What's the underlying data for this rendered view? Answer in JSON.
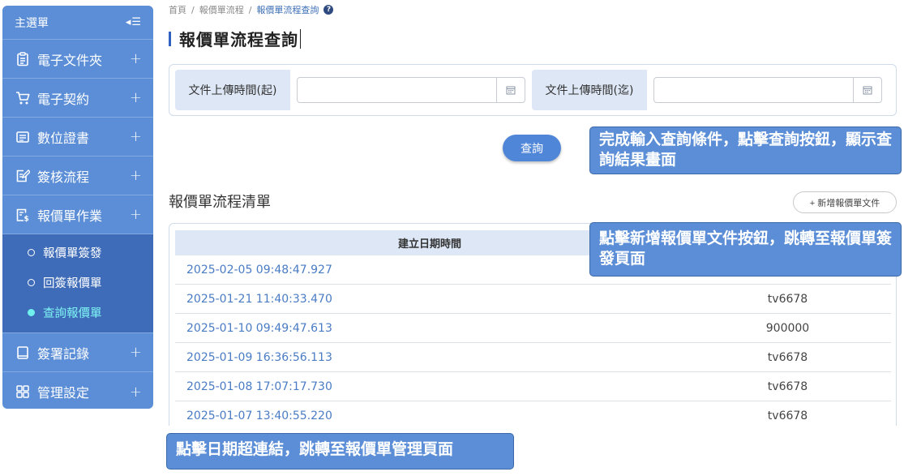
{
  "sidebar": {
    "header": "主選單",
    "toggle": "◂☰",
    "items": [
      {
        "label": "電子文件夾",
        "icon": "clipboard-icon"
      },
      {
        "label": "電子契約",
        "icon": "cart-icon"
      },
      {
        "label": "數位證書",
        "icon": "certificate-icon"
      },
      {
        "label": "簽核流程",
        "icon": "edit-document-icon"
      },
      {
        "label": "報價單作業",
        "icon": "quote-dollar-icon"
      },
      {
        "label": "簽署記錄",
        "icon": "book-icon"
      },
      {
        "label": "管理設定",
        "icon": "grid-icon"
      }
    ],
    "plus": "+",
    "subitems": [
      {
        "label": "報價單簽發",
        "active": false
      },
      {
        "label": "回簽報價單",
        "active": false
      },
      {
        "label": "查詢報價單",
        "active": true
      }
    ]
  },
  "breadcrumb": {
    "items": [
      "首頁",
      "報價單流程",
      "報價單流程查詢"
    ],
    "sep": "/"
  },
  "page": {
    "title": "報價單流程查詢"
  },
  "search": {
    "start_label": "文件上傳時間(起)",
    "end_label": "文件上傳時間(迄)",
    "start_value": "",
    "end_value": "",
    "query_button": "查詢"
  },
  "list": {
    "title": "報價單流程清單",
    "add_button": "+ 新增報價單文件",
    "column_date": "建立日期時間",
    "rows": [
      {
        "date": "2025-02-05 09:48:47.927",
        "user": ""
      },
      {
        "date": "2025-01-21 11:40:33.470",
        "user": "tv6678"
      },
      {
        "date": "2025-01-10 09:49:47.613",
        "user": "900000"
      },
      {
        "date": "2025-01-09 16:36:56.113",
        "user": "tv6678"
      },
      {
        "date": "2025-01-08 17:07:17.730",
        "user": "tv6678"
      },
      {
        "date": "2025-01-07 13:40:55.220",
        "user": "tv6678"
      }
    ]
  },
  "callouts": {
    "query": "完成輸入查詢條件，點擊查詢按鈕，顯示查詢結果畫面",
    "add": "點擊新增報價單文件按鈕，跳轉至報價單簽發頁面",
    "date_link": "點擊日期超連結，跳轉至報價單管理頁面"
  }
}
